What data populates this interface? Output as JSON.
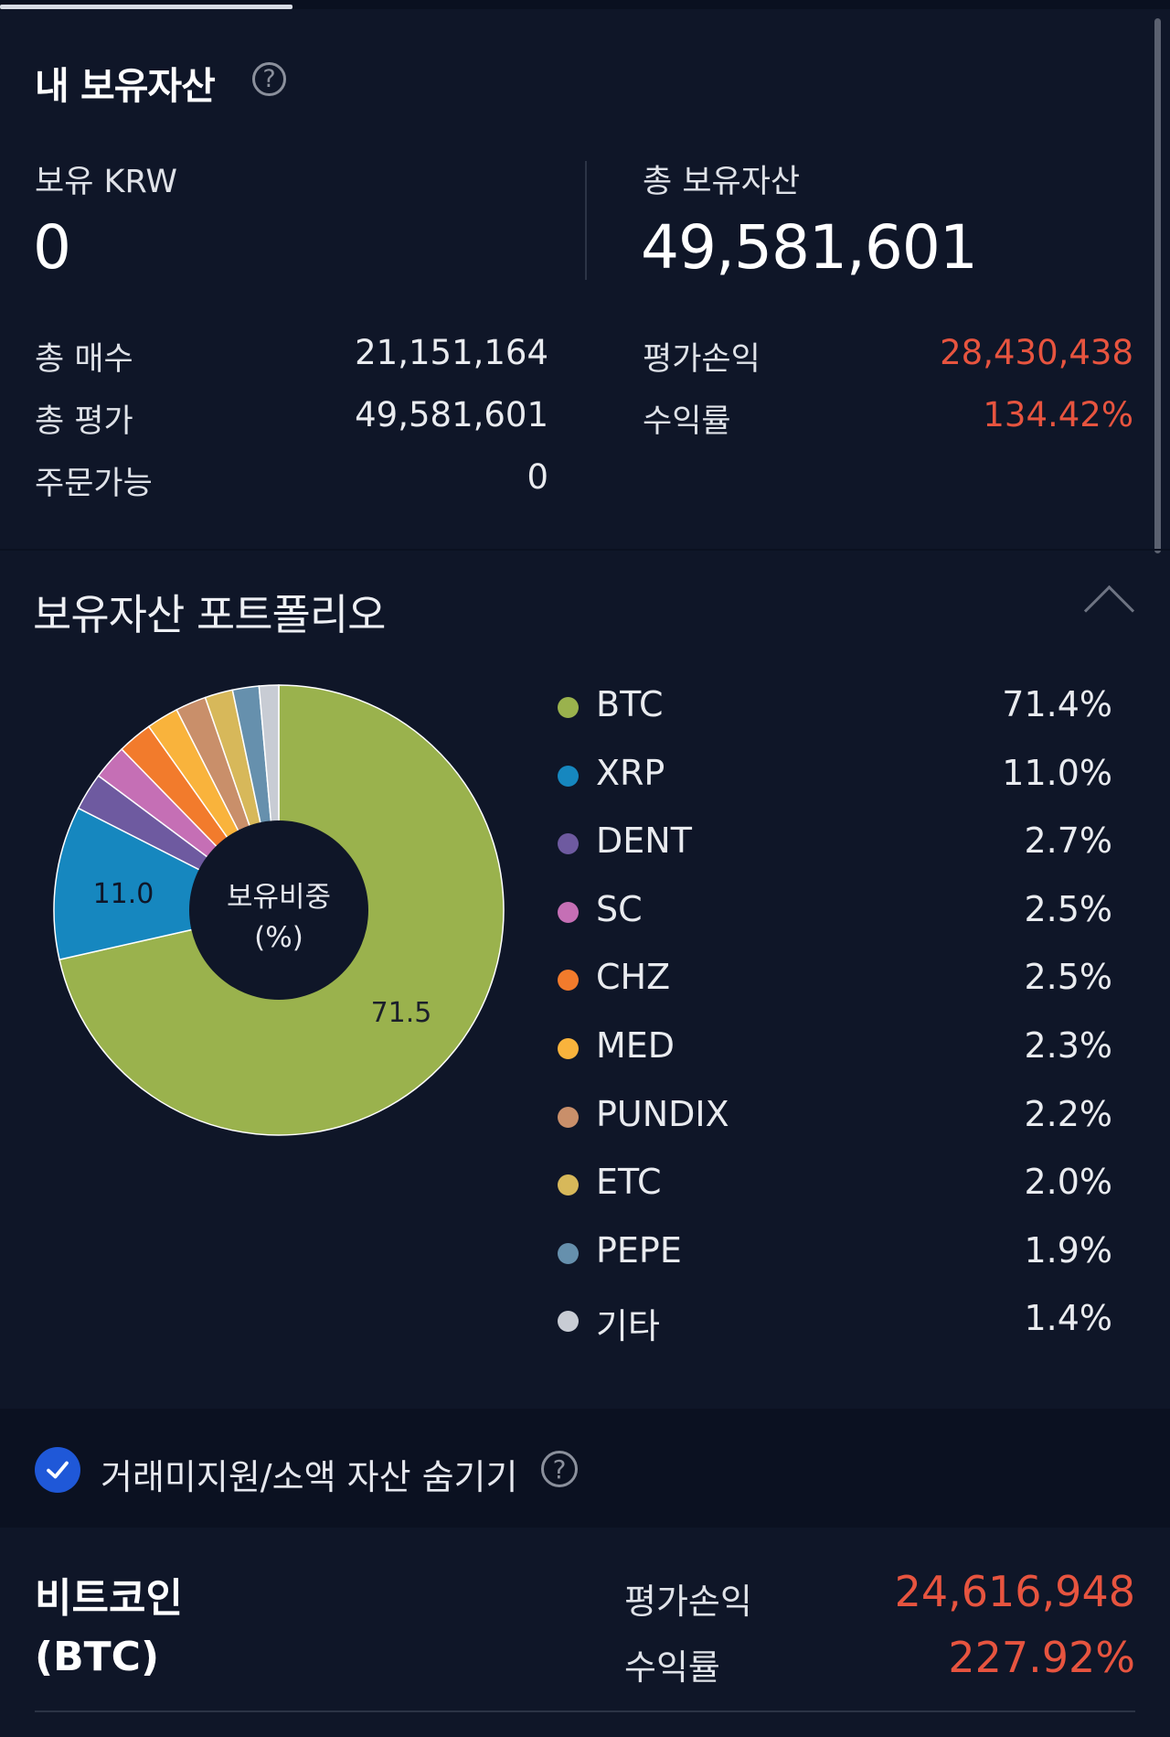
{
  "summary": {
    "title": "내 보유자산",
    "krw_label": "보유 KRW",
    "krw_value": "0",
    "total_label": "총 보유자산",
    "total_value": "49,581,601",
    "rows_left": [
      {
        "label": "총 매수",
        "value": "21,151,164"
      },
      {
        "label": "총 평가",
        "value": "49,581,601"
      },
      {
        "label": "주문가능",
        "value": "0"
      }
    ],
    "rows_right": [
      {
        "label": "평가손익",
        "value": "28,430,438"
      },
      {
        "label": "수익률",
        "value": "134.42%"
      }
    ]
  },
  "portfolio": {
    "title": "보유자산 포트폴리오",
    "center_label_line1": "보유비중",
    "center_label_line2": "(%)",
    "legend": [
      {
        "name": "BTC",
        "pct": "71.4%",
        "color": "#9ab24d"
      },
      {
        "name": "XRP",
        "pct": "11.0%",
        "color": "#1687bf"
      },
      {
        "name": "DENT",
        "pct": "2.7%",
        "color": "#6e5aa0"
      },
      {
        "name": "SC",
        "pct": "2.5%",
        "color": "#c56fb5"
      },
      {
        "name": "CHZ",
        "pct": "2.5%",
        "color": "#f27b2c"
      },
      {
        "name": "MED",
        "pct": "2.3%",
        "color": "#f9b33c"
      },
      {
        "name": "PUNDIX",
        "pct": "2.2%",
        "color": "#c98f6a"
      },
      {
        "name": "ETC",
        "pct": "2.0%",
        "color": "#d7b85a"
      },
      {
        "name": "PEPE",
        "pct": "1.9%",
        "color": "#6690ad"
      },
      {
        "name": "기타",
        "pct": "1.4%",
        "color": "#c8ccd4"
      }
    ]
  },
  "chart_data": {
    "type": "pie",
    "categories": [
      "BTC",
      "XRP",
      "DENT",
      "SC",
      "CHZ",
      "MED",
      "PUNDIX",
      "ETC",
      "PEPE",
      "기타"
    ],
    "values": [
      71.4,
      11.0,
      2.7,
      2.5,
      2.5,
      2.3,
      2.2,
      2.0,
      1.9,
      1.4
    ],
    "data_labels": [
      {
        "category": "BTC",
        "text": "71.5"
      },
      {
        "category": "XRP",
        "text": "11.0"
      }
    ]
  },
  "filter": {
    "hide_label": "거래미지원/소액 자산 숨기기",
    "checked": true
  },
  "coin": {
    "name_line1": "비트코인",
    "name_line2": "(BTC)",
    "pl_label": "평가손익",
    "pl_value": "24,616,948",
    "rate_label": "수익률",
    "rate_value": "227.92%"
  }
}
